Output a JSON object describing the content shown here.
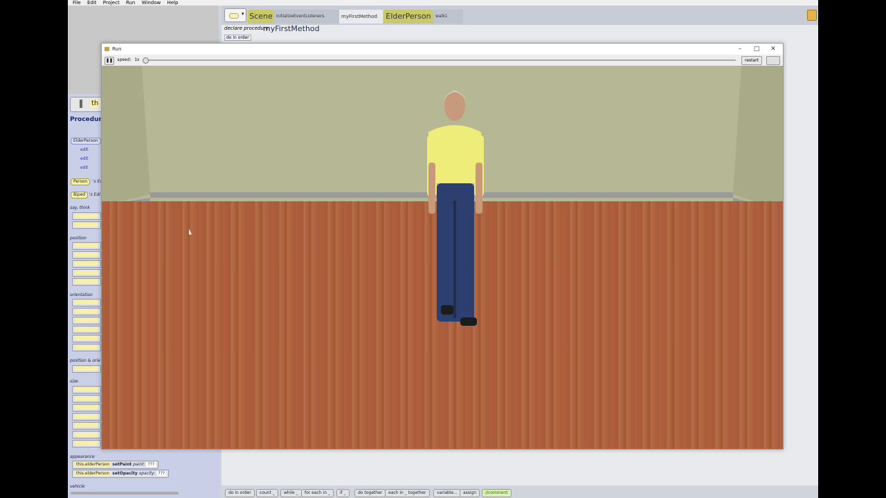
{
  "menubar": {
    "items": [
      "File",
      "Edit",
      "Project",
      "Run",
      "Window",
      "Help"
    ]
  },
  "tabs": [
    {
      "label": "Scene"
    },
    {
      "label": "initializeEventListeners"
    },
    {
      "label": "myFirstMethod"
    },
    {
      "label": "ElderPerson"
    },
    {
      "label": "walk1"
    }
  ],
  "editor": {
    "declare_prefix": "declare procedure",
    "method_name": "myFirstMethod",
    "do_in_order": "do in order"
  },
  "left_panel": {
    "this_label": "th",
    "header": "Procedure",
    "class_chip": "ElderPerson",
    "edit_label": "edit",
    "person_chip": "Person",
    "person_suffix": "'s Ed",
    "biped_chip": "Biped",
    "biped_suffix": "'s Edi",
    "categories": {
      "say_think": "say, think",
      "position": "position",
      "orientation": "orientation",
      "position_orientation": "position & orie",
      "size": "size",
      "appearance": "appearance",
      "vehicle": "vehicle"
    },
    "row_chip": "this.elderP",
    "appearance_rows": [
      {
        "target": "this.elderPerson",
        "method": "setPaint",
        "param": "paint:",
        "value": "???"
      },
      {
        "target": "this.elderPerson",
        "method": "setOpacity",
        "param": "opacity:",
        "value": "???"
      }
    ]
  },
  "bottom_bar": [
    "do in order",
    "count _",
    "while _",
    "for each in _",
    "if _",
    "do together",
    "each in _ together",
    "variable...",
    "assign",
    "//comment"
  ],
  "run_window": {
    "title": "Run",
    "speed_label": "speed: 1x",
    "restart_label": "restart",
    "speed_value": 0
  },
  "colors": {
    "wall": "#b6b795",
    "floor": "#b0603e",
    "scene_tab": "#c9c96a"
  }
}
